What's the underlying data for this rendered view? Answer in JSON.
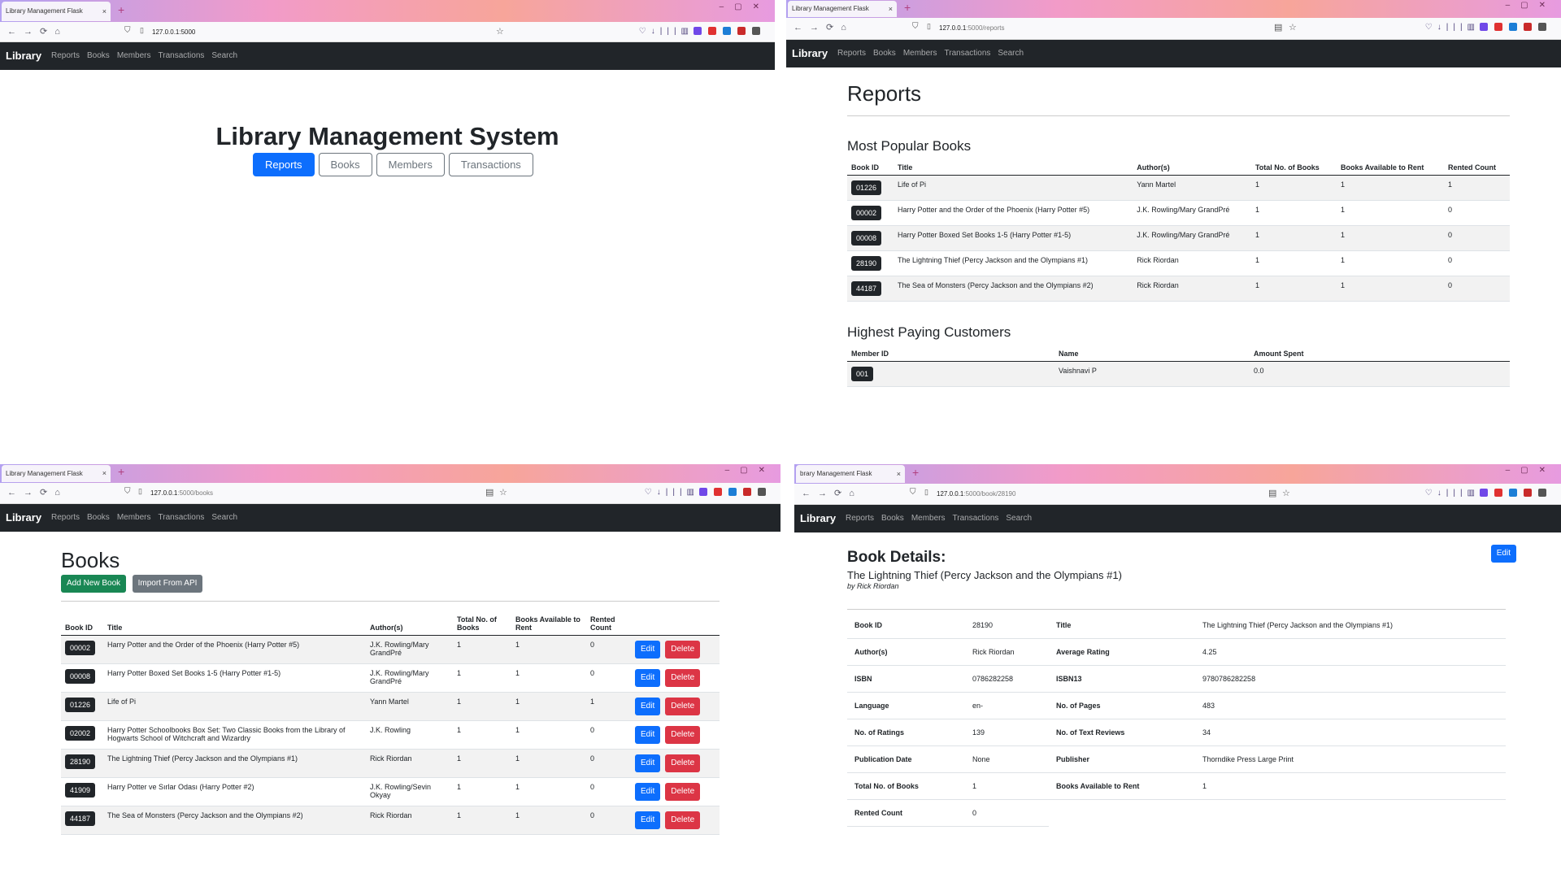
{
  "browser": {
    "tab_title": "Library Management Flask",
    "tab_title_cut": "brary Management Flask",
    "close_glyph": "×",
    "new_tab_glyph": "+",
    "window_controls": "–▢✕",
    "nav_glyphs": "←→⟳⌂",
    "shield_glyph": "⛉",
    "page_glyph": "▯",
    "star_glyph": "☆",
    "reader_glyph": "▤",
    "ext_glyphs": [
      "♡",
      "↓",
      "|||",
      "▥"
    ],
    "url_home": "127.0.0.1:5000",
    "url_host": "127.0.0.1",
    "url_reports_path": ":5000/reports",
    "url_books_path": ":5000/books",
    "url_book_path": ":5000/book/28190"
  },
  "navbar": {
    "brand": "Library",
    "links": [
      "Reports",
      "Books",
      "Members",
      "Transactions",
      "Search"
    ]
  },
  "home": {
    "title": "Library Management System",
    "buttons": [
      "Reports",
      "Books",
      "Members",
      "Transactions"
    ]
  },
  "reports": {
    "title": "Reports",
    "popular_title": "Most Popular Books",
    "popular_headers": [
      "Book ID",
      "Title",
      "Author(s)",
      "Total No. of Books",
      "Books Available to Rent",
      "Rented Count"
    ],
    "popular_rows": [
      [
        "01226",
        "Life of Pi",
        "Yann Martel",
        "1",
        "1",
        "1"
      ],
      [
        "00002",
        "Harry Potter and the Order of the Phoenix (Harry Potter #5)",
        "J.K. Rowling/Mary GrandPré",
        "1",
        "1",
        "0"
      ],
      [
        "00008",
        "Harry Potter Boxed Set Books 1-5 (Harry Potter #1-5)",
        "J.K. Rowling/Mary GrandPré",
        "1",
        "1",
        "0"
      ],
      [
        "28190",
        "The Lightning Thief (Percy Jackson and the Olympians #1)",
        "Rick Riordan",
        "1",
        "1",
        "0"
      ],
      [
        "44187",
        "The Sea of Monsters (Percy Jackson and the Olympians #2)",
        "Rick Riordan",
        "1",
        "1",
        "0"
      ]
    ],
    "customers_title": "Highest Paying Customers",
    "customers_headers": [
      "Member ID",
      "Name",
      "Amount Spent"
    ],
    "customers_rows": [
      [
        "001",
        "Vaishnavi P",
        "0.0"
      ]
    ]
  },
  "books": {
    "title": "Books",
    "add_button": "Add New Book",
    "import_button": "Import From API",
    "headers": [
      "Book ID",
      "Title",
      "Author(s)",
      "Total No. of Books",
      "Books Available to Rent",
      "Rented Count",
      ""
    ],
    "edit_label": "Edit",
    "delete_label": "Delete",
    "rows": [
      [
        "00002",
        "Harry Potter and the Order of the Phoenix (Harry Potter #5)",
        "J.K. Rowling/Mary GrandPré",
        "1",
        "1",
        "0"
      ],
      [
        "00008",
        "Harry Potter Boxed Set Books 1-5 (Harry Potter #1-5)",
        "J.K. Rowling/Mary GrandPré",
        "1",
        "1",
        "0"
      ],
      [
        "01226",
        "Life of Pi",
        "Yann Martel",
        "1",
        "1",
        "1"
      ],
      [
        "02002",
        "Harry Potter Schoolbooks Box Set: Two Classic Books from the Library of Hogwarts School of Witchcraft and Wizardry",
        "J.K. Rowling",
        "1",
        "1",
        "0"
      ],
      [
        "28190",
        "The Lightning Thief (Percy Jackson and the Olympians #1)",
        "Rick Riordan",
        "1",
        "1",
        "0"
      ],
      [
        "41909",
        "Harry Potter ve Sırlar Odası (Harry Potter #2)",
        "J.K. Rowling/Sevin Okyay",
        "1",
        "1",
        "0"
      ],
      [
        "44187",
        "The Sea of Monsters (Percy Jackson and the Olympians #2)",
        "Rick Riordan",
        "1",
        "1",
        "0"
      ]
    ]
  },
  "book_details": {
    "heading": "Book Details:",
    "edit_button": "Edit",
    "book_title": "The Lightning Thief (Percy Jackson and the Olympians #1)",
    "byline": "by Rick Riordan",
    "fields": [
      [
        "Book ID",
        "28190",
        "Title",
        "The Lightning Thief (Percy Jackson and the Olympians #1)"
      ],
      [
        "Author(s)",
        "Rick Riordan",
        "Average Rating",
        "4.25"
      ],
      [
        "ISBN",
        "0786282258",
        "ISBN13",
        "9780786282258"
      ],
      [
        "Language",
        "en-",
        "No. of Pages",
        "483"
      ],
      [
        "No. of Ratings",
        "139",
        "No. of Text Reviews",
        "34"
      ],
      [
        "Publication Date",
        "None",
        "Publisher",
        "Thorndike Press Large Print"
      ],
      [
        "Total No. of Books",
        "1",
        "Books Available to Rent",
        "1"
      ],
      [
        "Rented Count",
        "0",
        "",
        ""
      ]
    ]
  },
  "colors": {
    "navbar": "#212529",
    "primary": "#0d6efd",
    "danger": "#dc3545",
    "success": "#198754",
    "secondary": "#6c757d"
  }
}
